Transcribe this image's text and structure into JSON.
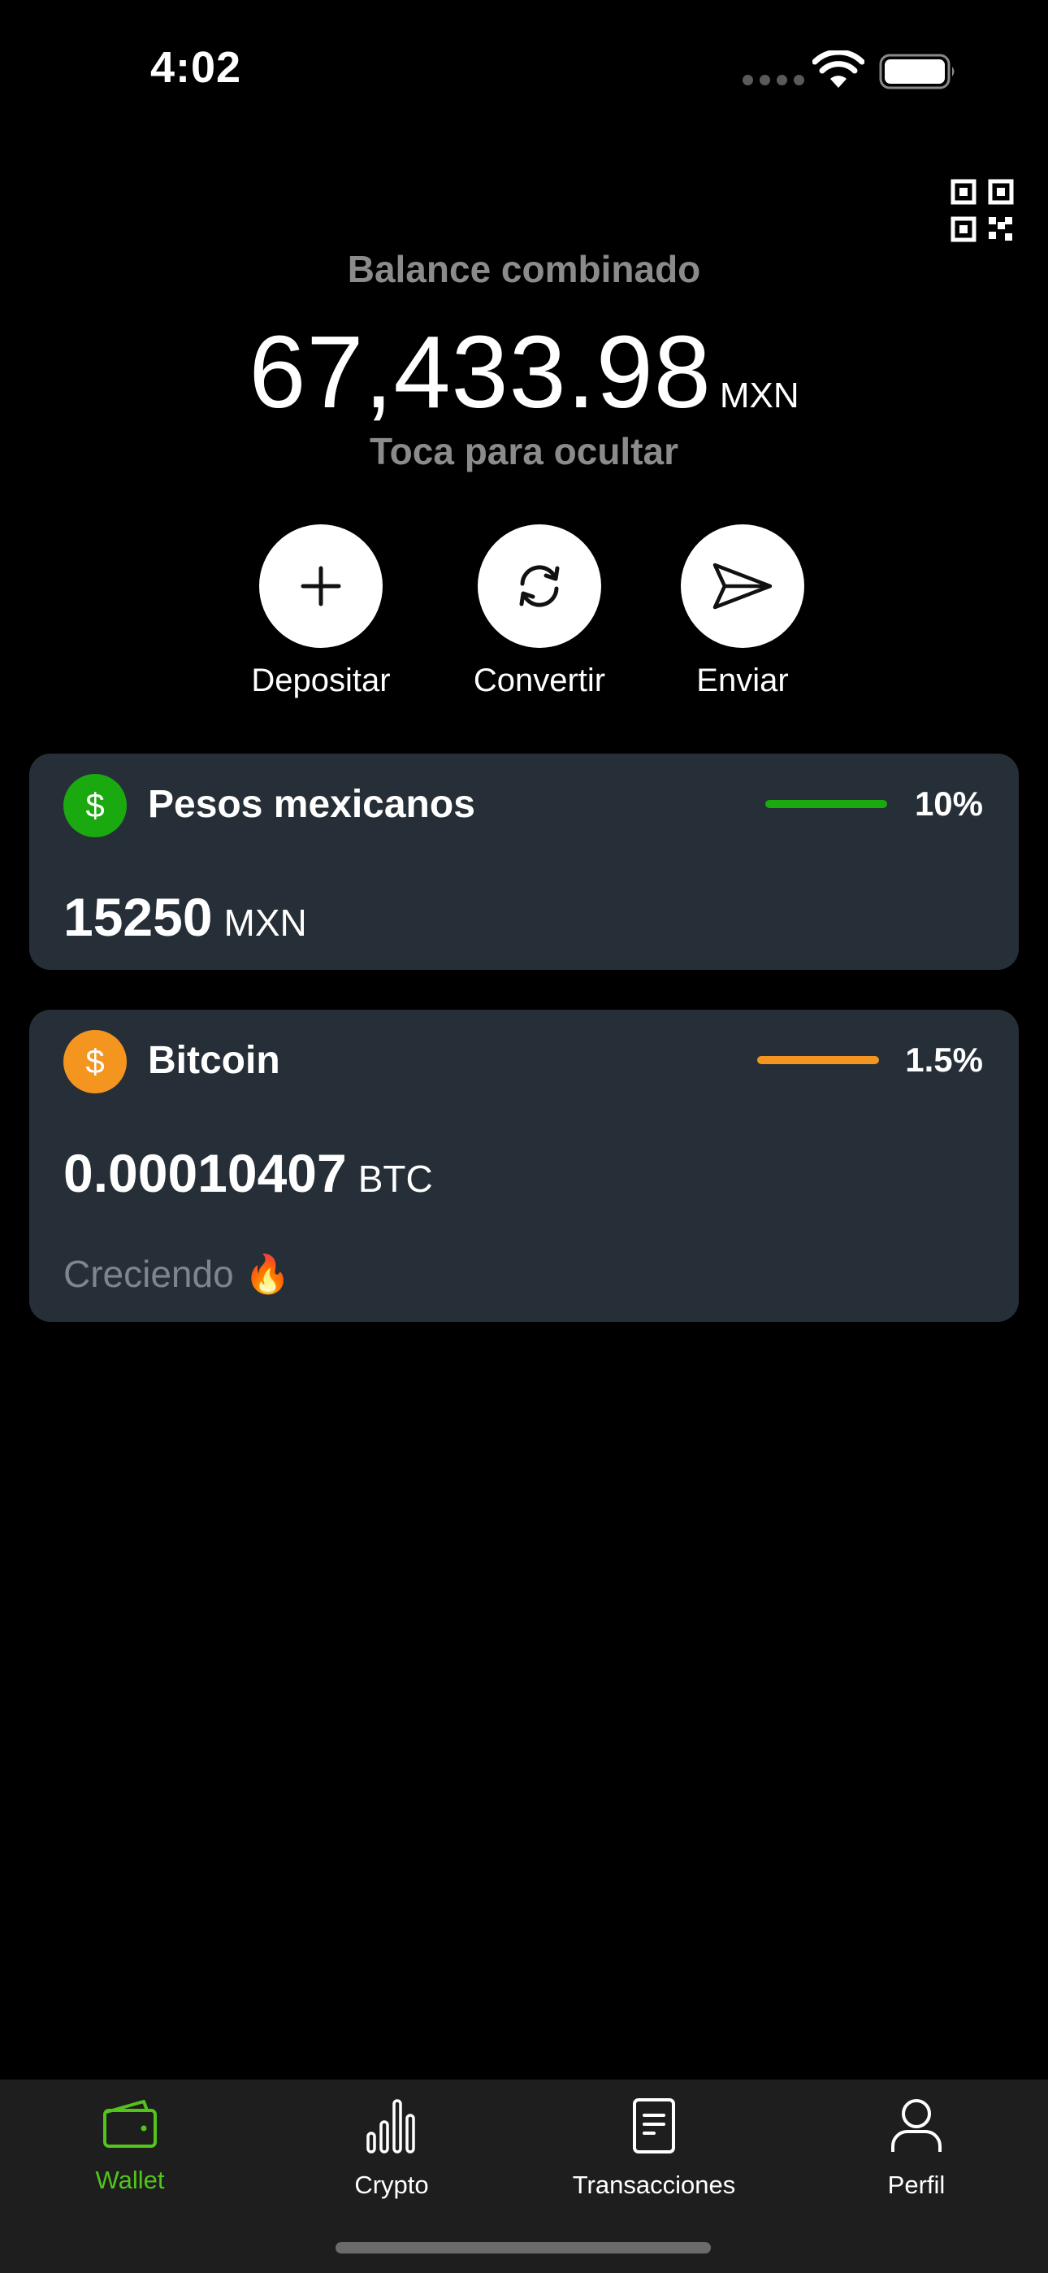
{
  "status_bar": {
    "time": "4:02"
  },
  "balance": {
    "label": "Balance combinado",
    "value": "67,433.98",
    "currency": "MXN",
    "hint": "Toca para ocultar"
  },
  "actions": [
    {
      "label": "Depositar",
      "icon": "plus-icon"
    },
    {
      "label": "Convertir",
      "icon": "convert-icon"
    },
    {
      "label": "Enviar",
      "icon": "send-icon"
    }
  ],
  "accounts": [
    {
      "name": "Pesos mexicanos",
      "symbol": "$",
      "color": "#1aa90e",
      "percent": "10%",
      "amount": "15250",
      "currency": "MXN",
      "note": ""
    },
    {
      "name": "Bitcoin",
      "symbol": "$",
      "color": "#f49520",
      "percent": "1.5%",
      "amount": "0.00010407",
      "currency": "BTC",
      "note": "Creciendo 🔥"
    }
  ],
  "nav": {
    "active_color": "#52c41a",
    "tabs": [
      {
        "label": "Wallet",
        "icon": "wallet-icon",
        "active": true
      },
      {
        "label": "Crypto",
        "icon": "chart-bars-icon",
        "active": false
      },
      {
        "label": "Transacciones",
        "icon": "document-icon",
        "active": false
      },
      {
        "label": "Perfil",
        "icon": "person-icon",
        "active": false
      }
    ]
  }
}
